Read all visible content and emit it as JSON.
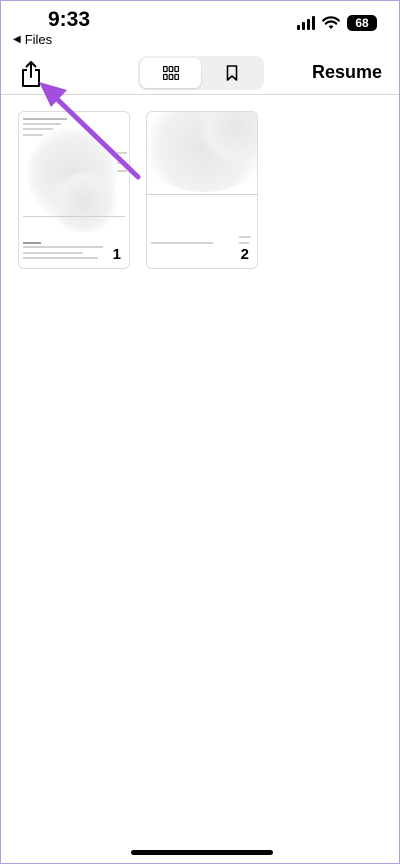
{
  "status_bar": {
    "time": "9:33",
    "back_label": "Files",
    "battery": "68"
  },
  "toolbar": {
    "share_icon": "share-icon",
    "view_options": [
      {
        "icon": "grid-icon",
        "selected": true
      },
      {
        "icon": "bookmark-icon",
        "selected": false
      }
    ],
    "resume_label": "Resume"
  },
  "pages": [
    {
      "number": "1"
    },
    {
      "number": "2"
    }
  ],
  "annotation": {
    "arrow_color": "#a24fe0"
  }
}
